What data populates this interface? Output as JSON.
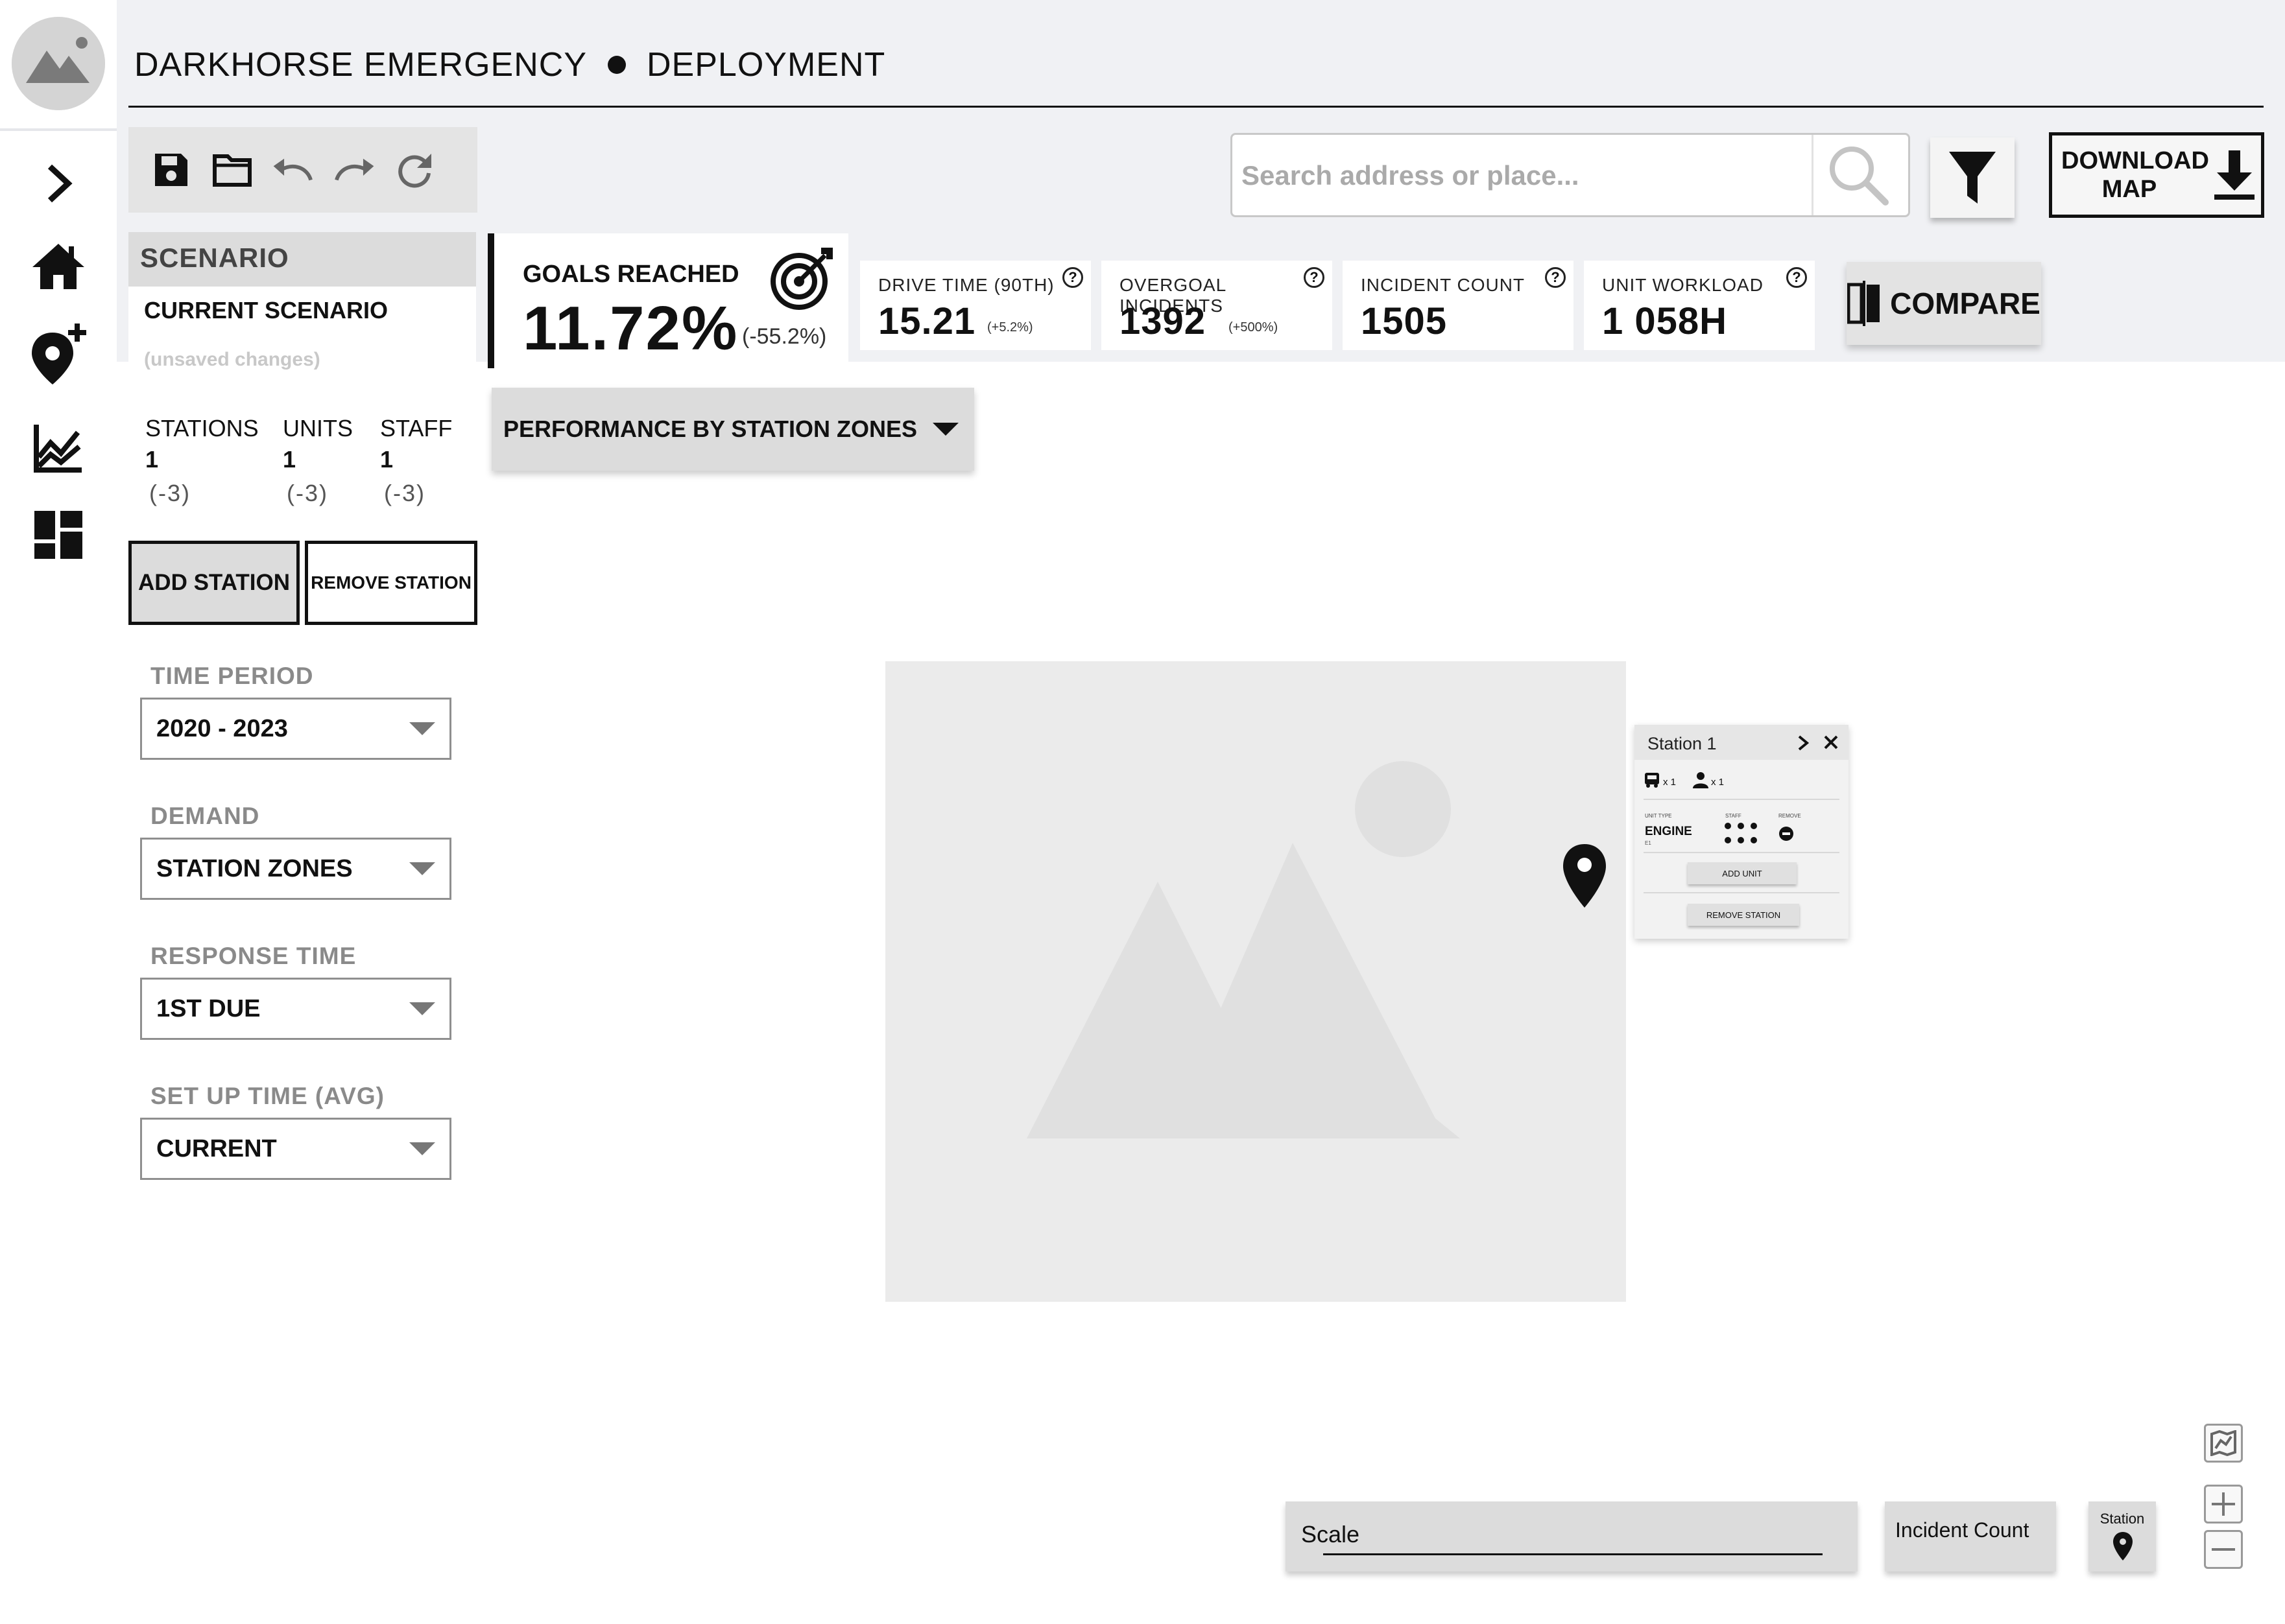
{
  "header": {
    "title_left": "DARKHORSE EMERGENCY",
    "title_right": "DEPLOYMENT"
  },
  "nav": {
    "items": [
      {
        "name": "expand",
        "icon": "chevron-right-icon"
      },
      {
        "name": "home",
        "icon": "home-icon"
      },
      {
        "name": "add-location",
        "icon": "add-location-icon"
      },
      {
        "name": "analytics",
        "icon": "chart-icon"
      },
      {
        "name": "dashboard",
        "icon": "dashboard-icon"
      }
    ]
  },
  "toolbar": {
    "tools": [
      "save-icon",
      "folder-icon",
      "undo-icon",
      "redo-icon",
      "refresh-icon"
    ]
  },
  "search": {
    "placeholder": "Search address or place..."
  },
  "download": {
    "label_line1": "DOWNLOAD",
    "label_line2": "MAP"
  },
  "scenario": {
    "heading": "SCENARIO",
    "name": "CURRENT SCENARIO",
    "status": "(unsaved changes)",
    "stats": [
      {
        "label": "STATIONS",
        "value": "1",
        "delta": "(-3)"
      },
      {
        "label": "UNITS",
        "value": "1",
        "delta": "(-3)"
      },
      {
        "label": "STAFF",
        "value": "1",
        "delta": "(-3)"
      }
    ],
    "add_station": "ADD STATION",
    "remove_station": "REMOVE STATION"
  },
  "filters": [
    {
      "label": "TIME PERIOD",
      "value": "2020 - 2023"
    },
    {
      "label": "DEMAND",
      "value": "STATION ZONES"
    },
    {
      "label": "RESPONSE TIME",
      "value": "1ST DUE"
    },
    {
      "label": "SET UP TIME (AVG)",
      "value": "CURRENT"
    }
  ],
  "goals": {
    "title": "GOALS REACHED",
    "value": "11.72%",
    "delta": "(-55.2%)"
  },
  "kpis": [
    {
      "title": "DRIVE TIME (90TH)",
      "value": "15.21",
      "delta": "(+5.2%)"
    },
    {
      "title": "OVERGOAL INCIDENTS",
      "value": "1392",
      "delta": "(+500%)"
    },
    {
      "title": "INCIDENT COUNT",
      "value": "1505",
      "delta": ""
    },
    {
      "title": "UNIT WORKLOAD",
      "value": "1 058H",
      "delta": ""
    }
  ],
  "kpi_help": "?",
  "compare": {
    "label": "COMPARE"
  },
  "performance_dropdown": {
    "label": "PERFORMANCE BY STATION ZONES"
  },
  "popup": {
    "title": "Station 1",
    "units_count": "x 1",
    "staff_count": "x 1",
    "col_unit_type": "UNIT TYPE",
    "col_staff": "STAFF",
    "col_remove": "REMOVE",
    "unit_type": "ENGINE",
    "unit_sub": "E1",
    "add_unit": "ADD UNIT",
    "remove_station": "REMOVE STATION"
  },
  "legend": {
    "scale": "Scale",
    "incident_count": "Incident Count",
    "station": "Station"
  },
  "colors": {
    "header_bg": "#f0f1f4",
    "accent": "#111111",
    "muted": "#8a8a8a",
    "map_placeholder": "#ebebeb"
  }
}
